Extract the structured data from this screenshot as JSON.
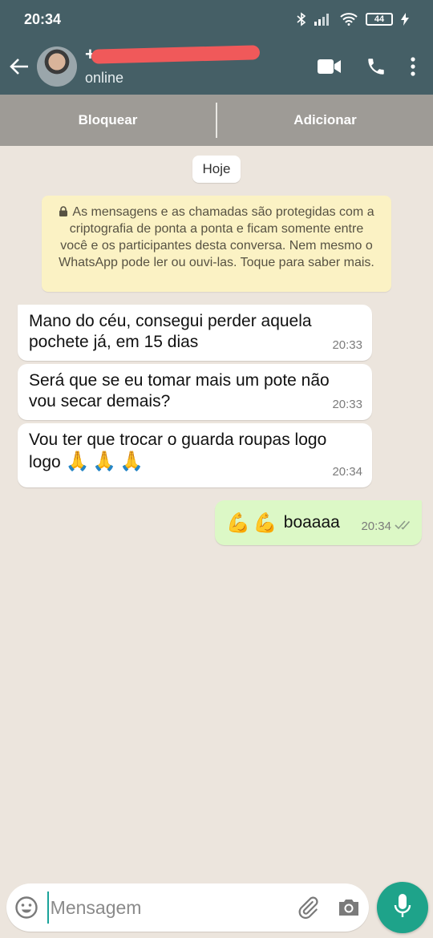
{
  "status_bar": {
    "time": "20:34",
    "battery": "44",
    "icons": [
      "bluetooth-icon",
      "signal-icon",
      "wifi-icon",
      "battery-icon",
      "charging-icon"
    ]
  },
  "header": {
    "contact_name": "+",
    "contact_status": "online",
    "icons": [
      "back-arrow-icon",
      "video-call-icon",
      "phone-icon",
      "more-options-icon"
    ]
  },
  "actions": {
    "block": "Bloquear",
    "add": "Adicionar"
  },
  "chat": {
    "date_chip": "Hoje",
    "encryption_notice": "As mensagens e as chamadas são protegidas com a criptografia de ponta a ponta e ficam somente entre você e os participantes desta conversa. Nem mesmo o WhatsApp pode ler ou ouvi-las. Toque para saber mais.",
    "messages": [
      {
        "direction": "in",
        "text": "Mano do céu, consegui perder aquela pochete já, em 15 dias",
        "time": "20:33"
      },
      {
        "direction": "in",
        "text": "Será que se eu tomar mais um pote não vou secar demais?",
        "time": "20:33"
      },
      {
        "direction": "in",
        "text": "Vou ter que trocar o guarda roupas logo logo",
        "emoji": "🙏🙏🙏",
        "time": "20:34"
      },
      {
        "direction": "out",
        "emoji": "💪💪",
        "text": "boaaaa",
        "time": "20:34",
        "status": "read"
      }
    ]
  },
  "input": {
    "placeholder": "Mensagem",
    "icons": [
      "emoji-icon",
      "attach-icon",
      "camera-icon",
      "mic-icon"
    ]
  },
  "colors": {
    "header": "#455f66",
    "chat_background": "#ece5dd",
    "outgoing_bubble": "#dcf8c6",
    "notice": "#fbf2c4",
    "accent": "#1ea38a"
  }
}
